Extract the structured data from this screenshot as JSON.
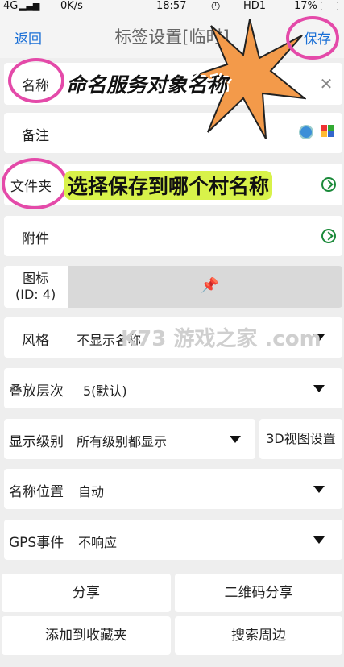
{
  "status_bar": {
    "network": "4G",
    "speed": "0K/s",
    "time": "18:57",
    "carrier": "HD1",
    "battery": "17%"
  },
  "nav": {
    "back": "返回",
    "title": "标签设置[临时]",
    "save": "保存"
  },
  "form": {
    "name_label": "名称",
    "note_label": "备注",
    "folder_label": "文件夹",
    "attachment_label": "附件",
    "icon_label": "图标\n(ID: 4)",
    "style_label": "风格",
    "style_value": "不显示名称",
    "stack_label": "叠放层次",
    "stack_value": "5(默认)",
    "level_label": "显示级别",
    "level_value": "所有级别都显示",
    "view3d_button": "3D视图设置",
    "namepos_label": "名称位置",
    "namepos_value": "自动",
    "gps_label": "GPS事件",
    "gps_value": "不响应"
  },
  "buttons": {
    "share": "分享",
    "qr_share": "二维码分享",
    "favorite": "添加到收藏夹",
    "search_nearby": "搜索周边"
  },
  "annotations": {
    "name_hint": "命名服务对象名称",
    "folder_hint": "选择保存到哪个村名称"
  },
  "watermark": "K73 游戏之家 .com",
  "colors": {
    "link": "#1a6fd6",
    "annotation": "#e44aa9",
    "highlight": "#d8f24a",
    "burst": "#f39a4a"
  }
}
